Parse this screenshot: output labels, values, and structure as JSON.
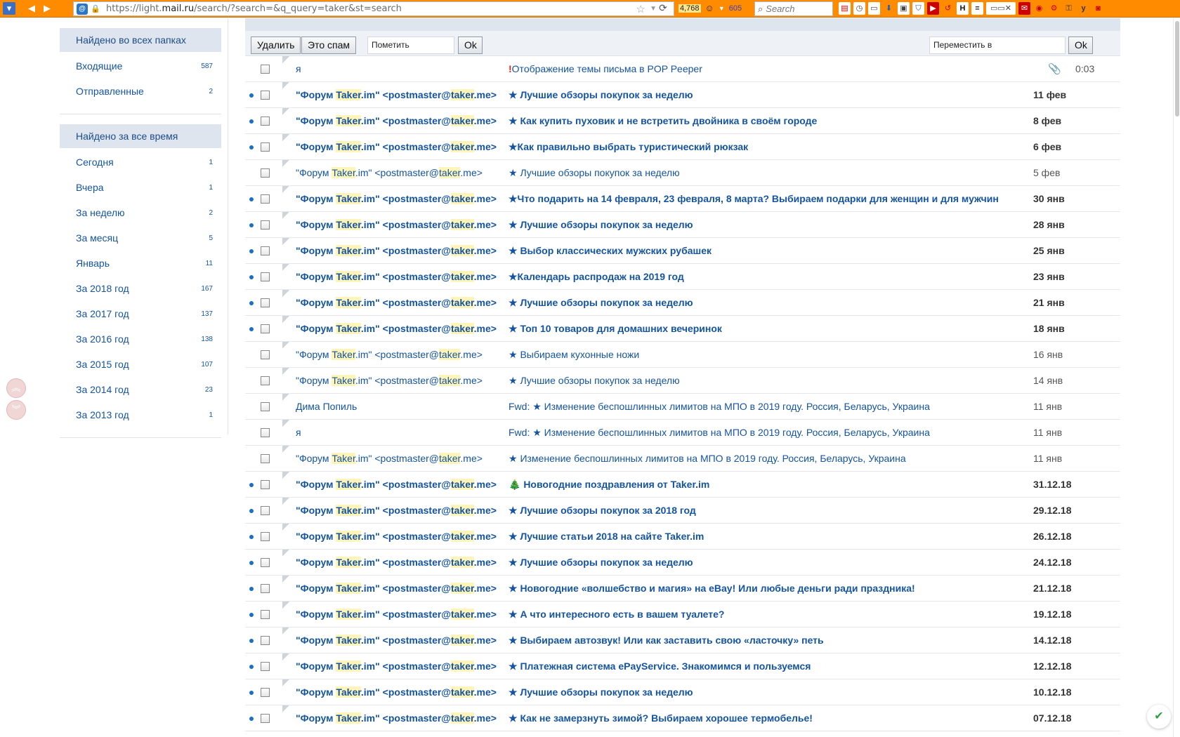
{
  "browser": {
    "url_prefix": "https://light.",
    "url_host": "mail.ru",
    "url_path": "/search/?search=&q_query=taker&st=search",
    "counter_main": "4,768",
    "counter_secondary": "605",
    "search_placeholder": "Search",
    "site_icon": "@"
  },
  "sidebar": {
    "folders_head": "Найдено во всех папках",
    "folders": [
      {
        "label": "Входящие",
        "count": "587"
      },
      {
        "label": "Отправленные",
        "count": "2"
      }
    ],
    "period_head": "Найдено за все время",
    "periods": [
      {
        "label": "Сегодня",
        "count": "1"
      },
      {
        "label": "Вчера",
        "count": "1"
      },
      {
        "label": "За неделю",
        "count": "2"
      },
      {
        "label": "За месяц",
        "count": "5"
      },
      {
        "label": "Январь",
        "count": "11"
      },
      {
        "label": "За 2018 год",
        "count": "167"
      },
      {
        "label": "За 2017 год",
        "count": "137"
      },
      {
        "label": "За 2016 год",
        "count": "138"
      },
      {
        "label": "За 2015 год",
        "count": "107"
      },
      {
        "label": "За 2014 год",
        "count": "23"
      },
      {
        "label": "За 2013 год",
        "count": "1"
      }
    ]
  },
  "actions": {
    "delete_label": "Удалить",
    "spam_label": "Это спам",
    "mark_value": "Пометить",
    "ok_label": "Ok",
    "move_value": "Переместить в",
    "ok2_label": "Ok"
  },
  "messages": [
    {
      "unread": false,
      "from": "я",
      "subject": "Отображение темы письма в POP Peeper",
      "important": true,
      "attachment": true,
      "date": "0:03"
    },
    {
      "unread": true,
      "from": "\"Форум Taker.im\" <postmaster@taker.me>",
      "subject": "★ Лучшие обзоры покупок за неделю",
      "date": "11 фев"
    },
    {
      "unread": true,
      "from": "\"Форум Taker.im\" <postmaster@taker.me>",
      "subject": "★ Как купить пуховик и не встретить двойника в своём городе",
      "date": "8 фев"
    },
    {
      "unread": true,
      "from": "\"Форум Taker.im\" <postmaster@taker.me>",
      "subject": "★Как правильно выбрать туристический рюкзак",
      "date": "6 фев"
    },
    {
      "unread": false,
      "from": "\"Форум Taker.im\" <postmaster@taker.me>",
      "subject": "★ Лучшие обзоры покупок за неделю",
      "date": "5 фев"
    },
    {
      "unread": true,
      "from": "\"Форум Taker.im\" <postmaster@taker.me>",
      "subject": "★Что подарить на 14 февраля, 23 февраля, 8 марта? Выбираем подарки для женщин и для мужчин",
      "date": "30 янв"
    },
    {
      "unread": true,
      "from": "\"Форум Taker.im\" <postmaster@taker.me>",
      "subject": "★ Лучшие обзоры покупок за неделю",
      "date": "28 янв"
    },
    {
      "unread": true,
      "from": "\"Форум Taker.im\" <postmaster@taker.me>",
      "subject": "★ Выбор классических мужских рубашек",
      "date": "25 янв"
    },
    {
      "unread": true,
      "from": "\"Форум Taker.im\" <postmaster@taker.me>",
      "subject": "★Календарь распродаж на 2019 год",
      "date": "23 янв"
    },
    {
      "unread": true,
      "from": "\"Форум Taker.im\" <postmaster@taker.me>",
      "subject": "★ Лучшие обзоры покупок за неделю",
      "date": "21 янв"
    },
    {
      "unread": true,
      "from": "\"Форум Taker.im\" <postmaster@taker.me>",
      "subject": "★ Топ 10 товаров для домашних вечеринок",
      "date": "18 янв"
    },
    {
      "unread": false,
      "from": "\"Форум Taker.im\" <postmaster@taker.me>",
      "subject": "★ Выбираем кухонные ножи",
      "date": "16 янв"
    },
    {
      "unread": false,
      "from": "\"Форум Taker.im\" <postmaster@taker.me>",
      "subject": "★ Лучшие обзоры покупок за неделю",
      "date": "14 янв"
    },
    {
      "unread": false,
      "from": "Дима Попиль",
      "subject": "Fwd: ★ Изменение беспошлинных лимитов на МПО в 2019 году. Россия, Беларусь, Украина",
      "date": "11 янв"
    },
    {
      "unread": false,
      "from": "я",
      "subject": "Fwd: ★ Изменение беспошлинных лимитов на МПО в 2019 году. Россия, Беларусь, Украина",
      "date": "11 янв"
    },
    {
      "unread": false,
      "from": "\"Форум Taker.im\" <postmaster@taker.me>",
      "subject": "★ Изменение беспошлинных лимитов на МПО в 2019 году. Россия, Беларусь, Украина",
      "date": "11 янв"
    },
    {
      "unread": true,
      "from": "\"Форум Taker.im\" <postmaster@taker.me>",
      "subject": "🎄 Новогодние поздравления от Taker.im",
      "date": "31.12.18"
    },
    {
      "unread": true,
      "from": "\"Форум Taker.im\" <postmaster@taker.me>",
      "subject": "★ Лучшие обзоры покупок за 2018 год",
      "date": "29.12.18"
    },
    {
      "unread": true,
      "from": "\"Форум Taker.im\" <postmaster@taker.me>",
      "subject": "★ Лучшие статьи 2018 на сайте Taker.im",
      "date": "26.12.18"
    },
    {
      "unread": true,
      "from": "\"Форум Taker.im\" <postmaster@taker.me>",
      "subject": "★ Лучшие обзоры покупок за неделю",
      "date": "24.12.18"
    },
    {
      "unread": true,
      "from": "\"Форум Taker.im\" <postmaster@taker.me>",
      "subject": "★ Новогодние «волшебство и магия» на eBay! Или любые деньги ради праздника!",
      "date": "21.12.18"
    },
    {
      "unread": true,
      "from": "\"Форум Taker.im\" <postmaster@taker.me>",
      "subject": "★ А что интересного есть в вашем туалете?",
      "date": "19.12.18"
    },
    {
      "unread": true,
      "from": "\"Форум Taker.im\" <postmaster@taker.me>",
      "subject": "★ Выбираем автозвук! Или как заставить свою «ласточку» петь",
      "date": "14.12.18"
    },
    {
      "unread": true,
      "from": "\"Форум Taker.im\" <postmaster@taker.me>",
      "subject": "★ Платежная система ePayService. Знакомимся и пользуемся",
      "date": "12.12.18"
    },
    {
      "unread": true,
      "from": "\"Форум Taker.im\" <postmaster@taker.me>",
      "subject": "★ Лучшие обзоры покупок за неделю",
      "date": "10.12.18"
    },
    {
      "unread": true,
      "from": "\"Форум Taker.im\" <postmaster@taker.me>",
      "subject": "★ Как не замерзнуть зимой? Выбираем хорошее термобелье!",
      "date": "07.12.18"
    }
  ],
  "colors": {
    "toolbar": "#ff8c00",
    "link": "#1554a0",
    "unread_dot": "#1a6fc9",
    "highlight": "#fff5b8"
  },
  "icons": {
    "important": "!",
    "attachment": "📎",
    "scroll_up": "︽",
    "scroll_down": "︾",
    "shield": "✔"
  }
}
